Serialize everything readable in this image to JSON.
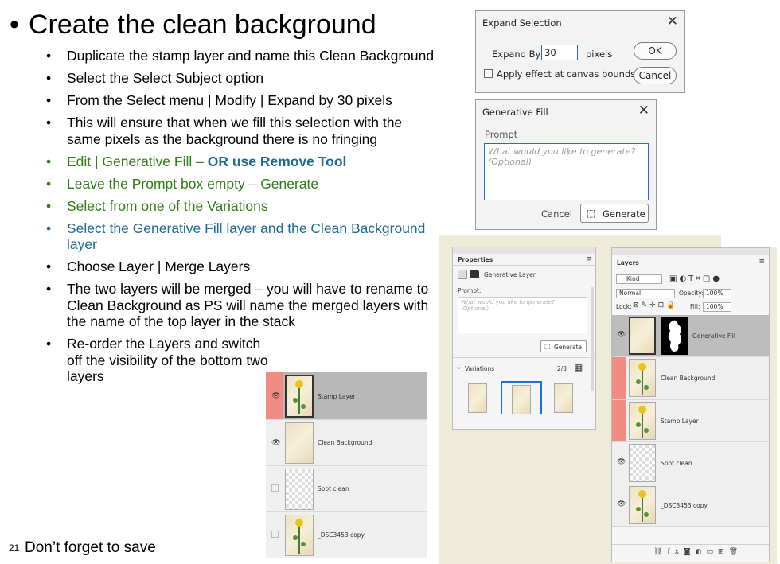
{
  "slide": {
    "title": "Create the clean background",
    "bullets": [
      {
        "text": "Duplicate the stamp layer and name this Clean Background",
        "color": "#000000"
      },
      {
        "text": "Select the Select Subject option",
        "color": "#000000"
      },
      {
        "text": "From the Select menu | Modify | Expand by 30 pixels",
        "color": "#000000"
      },
      {
        "text": "This will ensure that when we fill this selection with the same pixels as the background there is no fringing",
        "color": "#000000"
      },
      {
        "text_prefix": "Edit | Generative Fill – ",
        "text_strong": "OR use Remove Tool",
        "color": "#2f7d16"
      },
      {
        "text": "Leave the Prompt box empty – Generate",
        "color": "#2f7d16"
      },
      {
        "text": "Select from one of the Variations",
        "color": "#2f7d16"
      },
      {
        "text": "Select the Generative Fill layer and the Clean Background layer",
        "color": "#1d6b94"
      },
      {
        "text": "Choose Layer | Merge Layers",
        "color": "#000000"
      },
      {
        "text": "The two layers will be merged – you will have to rename to Clean Background as PS will name the merged layers with the name of the top layer in the stack",
        "color": "#000000"
      },
      {
        "text": "Re-order the Layers and switch off the visibility of the bottom two layers",
        "color": "#000000"
      }
    ],
    "slide_number": "21",
    "footer": "Don’t forget to save"
  },
  "expand_dialog": {
    "title": "Expand Selection",
    "close_icon": "close-icon",
    "label": "Expand By:",
    "value": "30",
    "unit": "pixels",
    "checkbox_label": "Apply effect at canvas bounds",
    "ok": "OK",
    "cancel": "Cancel"
  },
  "genfill_dialog": {
    "title": "Generative Fill",
    "prompt_label": "Prompt",
    "placeholder": "What would you like to generate? (Optional)",
    "cancel": "Cancel",
    "generate": "Generate"
  },
  "small_layers": {
    "rows": [
      {
        "name": "Stamp Layer",
        "visible": true,
        "thumb": "flower",
        "selected": true
      },
      {
        "name": "Clean Background",
        "visible": true,
        "thumb": "paper",
        "selected": false
      },
      {
        "name": "Spot clean",
        "visible": false,
        "thumb": "checker",
        "selected": false
      },
      {
        "name": "_DSC3453 copy",
        "visible": false,
        "thumb": "flower",
        "selected": false
      }
    ]
  },
  "properties_panel": {
    "title": "Properties",
    "layer_type": "Generative Layer",
    "prompt_label": "Prompt:",
    "placeholder": "What would you like to generate? (Optional)",
    "generate": "Generate",
    "variations_label": "Variations",
    "variations_count": "2/3"
  },
  "layers_panel": {
    "title": "Layers",
    "kind": "Kind",
    "blend": "Normal",
    "opacity_label": "Opacity:",
    "opacity": "100%",
    "lock_label": "Lock:",
    "fill_label": "Fill:",
    "fill": "100%",
    "rows": [
      {
        "name": "Generative Fill",
        "visible": true,
        "thumb": "paper",
        "mask": true,
        "selected": true
      },
      {
        "name": "Clean Background",
        "visible": true,
        "thumb": "flower",
        "selected": false
      },
      {
        "name": "Stamp Layer",
        "visible": true,
        "thumb": "flower",
        "selected": false
      },
      {
        "name": "Spot clean",
        "visible": true,
        "thumb": "checker",
        "selected": false
      },
      {
        "name": "_DSC3453 copy",
        "visible": true,
        "thumb": "flower",
        "selected": false
      }
    ],
    "footer_icons": [
      "link-icon",
      "fx-icon",
      "mask-icon",
      "adjustment-icon",
      "folder-icon",
      "new-layer-icon",
      "trash-icon"
    ]
  }
}
